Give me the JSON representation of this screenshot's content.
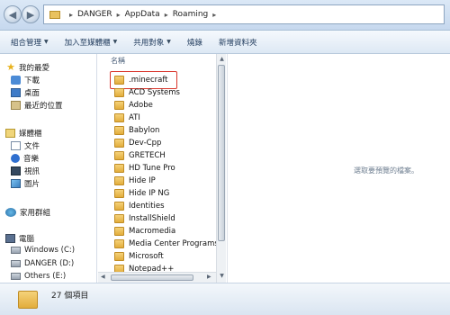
{
  "address_bar": {
    "path": [
      "DANGER",
      "AppData",
      "Roaming"
    ]
  },
  "toolbar": {
    "organize": "組合管理",
    "add_to_library": "加入至媒體櫃",
    "share_with": "共用對象",
    "burn": "燒錄",
    "new_folder": "新增資料夾"
  },
  "nav": {
    "favorites": "我的最愛",
    "downloads": "下載",
    "desktop": "桌面",
    "recent_places": "最近的位置",
    "libraries": "媒體櫃",
    "documents": "文件",
    "music": "音樂",
    "videos": "視訊",
    "pictures": "圖片",
    "homegroup": "家用群組",
    "computer": "電腦",
    "drive_c": "Windows (C:)",
    "drive_d": "DANGER (D:)",
    "drive_e": "Others (E:)"
  },
  "content": {
    "column_name": "名稱",
    "folders": [
      ".minecraft",
      "ACD Systems",
      "Adobe",
      "ATI",
      "Babylon",
      "Dev-Cpp",
      "GRETECH",
      "HD Tune Pro",
      "Hide IP",
      "Hide IP NG",
      "Identities",
      "InstallShield",
      "Macromedia",
      "Media Center Programs",
      "Microsoft",
      "Notepad++"
    ],
    "highlighted_folder": ".minecraft"
  },
  "preview": {
    "message": "選取要預覽的檔案。"
  },
  "details": {
    "item_count": "27 個項目"
  },
  "colors": {
    "highlight_border": "#d9352b",
    "folder_yellow": "#e2ad3b",
    "toolbar_bg": "#dde8f4"
  }
}
